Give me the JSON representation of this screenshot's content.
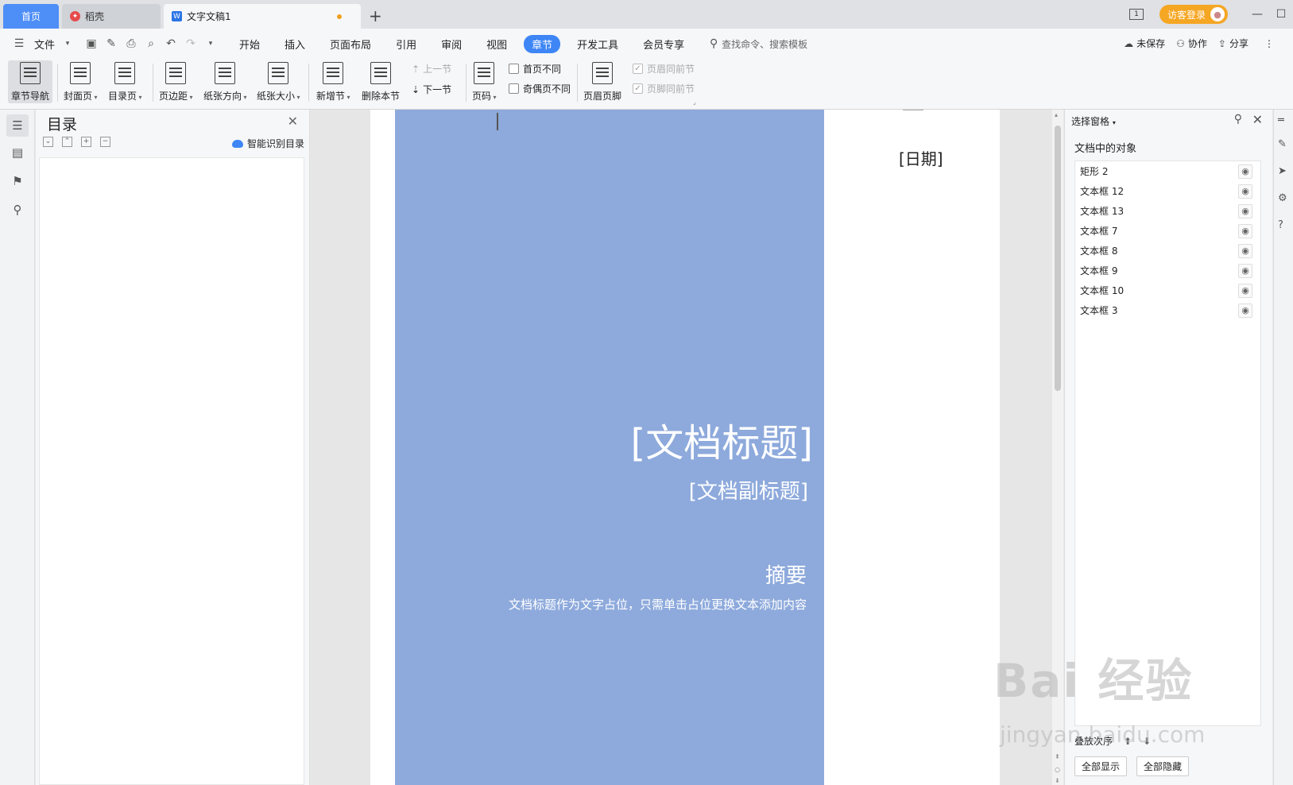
{
  "tabs": {
    "home": "首页",
    "daoke": "稻壳",
    "doc": "文字文稿1",
    "new": "+"
  },
  "titlebar": {
    "page_badge": "1",
    "login": "访客登录",
    "minimize": "—",
    "maximize": "☐"
  },
  "menubar": {
    "file": "文件",
    "items": [
      "开始",
      "插入",
      "页面布局",
      "引用",
      "审阅",
      "视图",
      "章节",
      "开发工具",
      "会员专享"
    ],
    "active": "章节",
    "search_placeholder": "查找命令、搜索模板",
    "unsaved": "未保存",
    "collab": "协作",
    "share": "分享"
  },
  "ribbon": {
    "nav": "章节导航",
    "cover": "封面页",
    "toc": "目录页",
    "margin": "页边距",
    "orientation": "纸张方向",
    "size": "纸张大小",
    "new_section": "新增节",
    "delete_section": "删除本节",
    "prev_section": "上一节",
    "next_section": "下一节",
    "page_num": "页码",
    "first_diff": "首页不同",
    "odd_even_diff": "奇偶页不同",
    "header_footer": "页眉页脚",
    "header_same": "页眉同前节",
    "footer_same": "页脚同前节"
  },
  "toc_panel": {
    "title": "目录",
    "smart": "智能识别目录"
  },
  "document": {
    "date": "[日期]",
    "title": "[文档标题]",
    "subtitle": "[文档副标题]",
    "abstract_head": "摘要",
    "abstract_body": "文档标题作为文字占位，只需单击占位更换文本添加内容",
    "cover_color": "#8eaadc"
  },
  "selection_pane": {
    "header": "选择窗格",
    "subtitle": "文档中的对象",
    "objects": [
      "矩形 2",
      "文本框 12",
      "文本框 13",
      "文本框 7",
      "文本框 8",
      "文本框 9",
      "文本框 10",
      "文本框 3"
    ],
    "order_label": "叠放次序",
    "show_all": "全部显示",
    "hide_all": "全部隐藏"
  },
  "watermark": {
    "main": "Bai 经验",
    "sub": "jingyan.baidu.com"
  }
}
